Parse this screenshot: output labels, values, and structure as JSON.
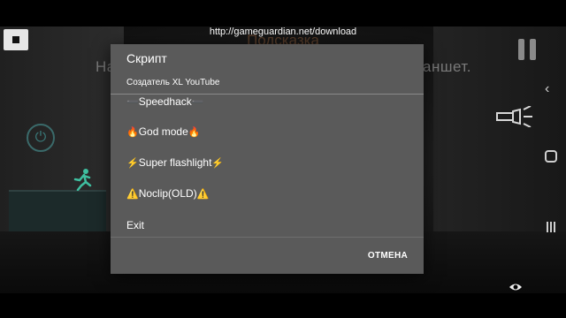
{
  "floating": {
    "url": "http://gameguardian.net/download"
  },
  "game_overlay": {
    "title_partial": "Подсказка",
    "hint_left": "На",
    "hint_right": "аншет."
  },
  "dialog": {
    "title": "Скрипт",
    "subtitle": "Создатель XL YouTube",
    "items": [
      {
        "prefix": "➖",
        "label": "Speedhack",
        "suffix": "➖"
      },
      {
        "prefix": "🔥",
        "label": "God mode",
        "suffix": "🔥"
      },
      {
        "prefix": "⚡",
        "label": "Super flashlight",
        "suffix": "⚡"
      },
      {
        "prefix": "⚠️",
        "label": "Noclip(OLD)",
        "suffix": "⚠️"
      },
      {
        "prefix": "",
        "label": "Exit",
        "suffix": ""
      }
    ],
    "cancel_label": "ОТМЕНА"
  },
  "icons": {
    "stop": "stop-icon",
    "pause": "pause-icon",
    "back": "back-icon",
    "home": "home-icon",
    "recents": "recents-icon",
    "power": "power-icon",
    "run": "running-man-icon",
    "flashlight": "flashlight-icon",
    "eye": "eye-icon"
  },
  "colors": {
    "dialog_bg": "#5a5a5a",
    "accent_flash": "#3fbfa0"
  }
}
